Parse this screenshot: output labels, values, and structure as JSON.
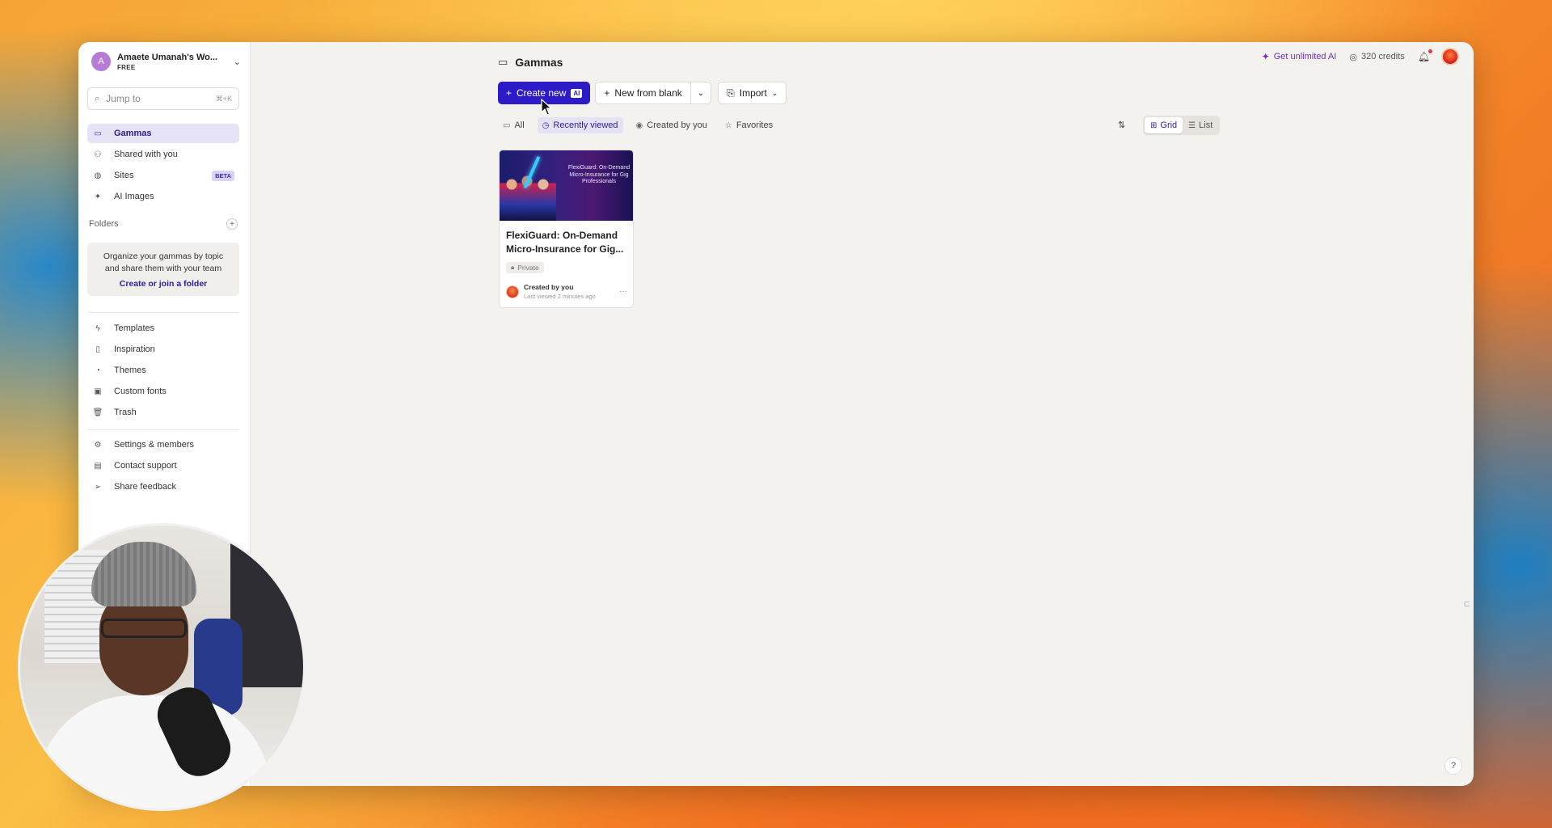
{
  "workspace": {
    "avatar_letter": "A",
    "name": "Amaete Umanah's Wo...",
    "plan": "FREE"
  },
  "search": {
    "placeholder": "Jump to",
    "shortcut": "⌘+K"
  },
  "sidebar": {
    "primary": [
      {
        "label": "Gammas",
        "icon": "gammas-icon",
        "active": true
      },
      {
        "label": "Shared with you",
        "icon": "users-icon"
      },
      {
        "label": "Sites",
        "icon": "globe-icon",
        "badge": "BETA"
      },
      {
        "label": "AI Images",
        "icon": "sparkle-icon"
      }
    ],
    "folders": {
      "title": "Folders",
      "empty_text": "Organize your gammas by topic and share them with your team",
      "link": "Create or join a folder"
    },
    "secondary": [
      {
        "label": "Templates",
        "icon": "bolt-icon"
      },
      {
        "label": "Inspiration",
        "icon": "book-icon"
      },
      {
        "label": "Themes",
        "icon": "palette-icon"
      },
      {
        "label": "Custom fonts",
        "icon": "font-icon"
      },
      {
        "label": "Trash",
        "icon": "trash-icon"
      }
    ],
    "tertiary": [
      {
        "label": "Settings & members",
        "icon": "settings-icon"
      },
      {
        "label": "Contact support",
        "icon": "chat-icon"
      },
      {
        "label": "Share feedback",
        "icon": "send-icon"
      }
    ]
  },
  "header": {
    "title": "Gammas",
    "get_ai": "Get unlimited AI",
    "credits": "320 credits"
  },
  "toolbar": {
    "create_new": "Create new",
    "ai_badge": "AI",
    "new_from_blank": "New from blank",
    "import": "Import"
  },
  "filters": [
    {
      "label": "All",
      "icon": "all-icon"
    },
    {
      "label": "Recently viewed",
      "icon": "clock-icon",
      "active": true
    },
    {
      "label": "Created by you",
      "icon": "user-circle-icon"
    },
    {
      "label": "Favorites",
      "icon": "star-icon"
    }
  ],
  "view": {
    "grid": "Grid",
    "list": "List",
    "selected": "Grid"
  },
  "cards": [
    {
      "title": "FlexiGuard: On-Demand Micro-Insurance for Gig...",
      "thumb_text": "FlexiGuard: On-Demand Micro-Insurance for Gig Professionals",
      "visibility": "Private",
      "creator": "Created by you",
      "last_viewed": "Last viewed 2 minutes ago"
    }
  ],
  "colors": {
    "accent": "#2d1bc8",
    "active_bg": "#e6e3f7",
    "ai_purple": "#7a2bc8"
  }
}
